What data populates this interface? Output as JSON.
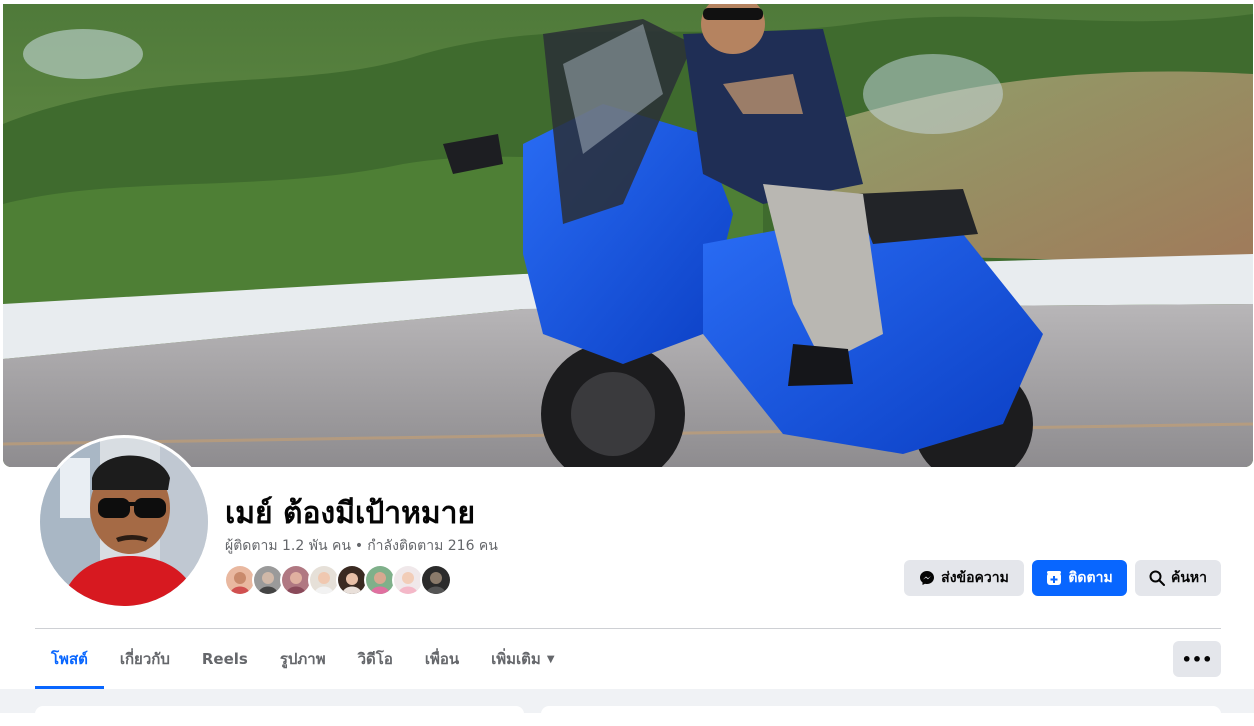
{
  "profile": {
    "name": "เมย์ ต้องมีเป้าหมาย",
    "followers": "ผู้ติดตาม 1.2 พัน คน",
    "separator": "•",
    "following": "กำลังติดตาม 216 คน"
  },
  "actions": {
    "message_label": "ส่งข้อความ",
    "follow_label": "ติดตาม",
    "search_label": "ค้นหา"
  },
  "tabs": [
    {
      "label": "โพสต์",
      "active": true
    },
    {
      "label": "เกี่ยวกับ"
    },
    {
      "label": "Reels"
    },
    {
      "label": "รูปภาพ"
    },
    {
      "label": "วิดีโอ"
    },
    {
      "label": "เพื่อน"
    },
    {
      "label": "เพิ่มเติม"
    }
  ],
  "more_menu_label": "•••",
  "colors": {
    "accent": "#0866ff",
    "secondary_button": "#e4e6eb",
    "muted_text": "#65676b",
    "page_background": "#f0f2f5"
  },
  "icons": {
    "message": "messenger-icon",
    "follow": "follow-plus-icon",
    "search": "search-icon",
    "more_caret": "caret-down-icon"
  }
}
